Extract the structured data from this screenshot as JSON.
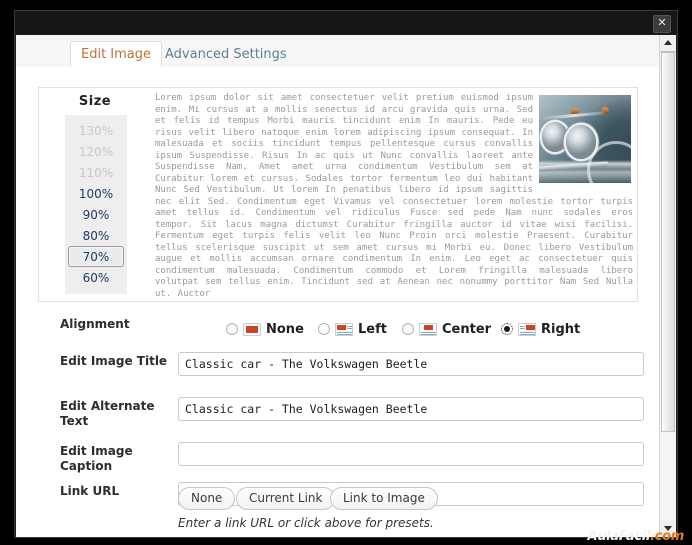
{
  "window": {
    "close_label": "✕"
  },
  "tabs": [
    {
      "label": "Edit Image",
      "active": true
    },
    {
      "label": "Advanced Settings",
      "active": false
    }
  ],
  "preview": {
    "size_heading": "Size",
    "size_options": [
      {
        "label": "130%",
        "state": "disabled"
      },
      {
        "label": "120%",
        "state": "disabled"
      },
      {
        "label": "110%",
        "state": "disabled"
      },
      {
        "label": "100%",
        "state": "enabled"
      },
      {
        "label": "90%",
        "state": "enabled"
      },
      {
        "label": "80%",
        "state": "enabled"
      },
      {
        "label": "70%",
        "state": "selected"
      },
      {
        "label": "60%",
        "state": "enabled"
      }
    ],
    "image_alt": "Classic car - The Volkswagen Beetle",
    "body_text": "Lorem ipsum dolor sit amet consectetuer velit pretium euismod ipsum enim. Mi cursus at a mollis senectus id arcu gravida quis urna. Sed et felis id tempus Morbi mauris tincidunt enim In mauris. Pede eu risus velit libero natoque enim lorem adipiscing ipsum consequat. In malesuada et sociis tincidunt tempus pellentesque cursus convallis ipsum Suspendisse. Risus In ac quis ut Nunc convallis laoreet ante Suspendisse Nam. Amet amet urna condimentum Vestibulum sem at Curabitur lorem et cursus. Sodales tortor fermentum leo dui habitant Nunc Sed Vestibulum. Ut lorem In penatibus libero id ipsum sagittis nec elit Sed. Condimentum eget Vivamus vel consectetuer lorem molestie tortor turpis amet tellus id. Condimentum vel ridiculus Fusce sed pede Nam nunc sodales eros tempor. Sit lacus magna dictumst Curabitur fringilla auctor id vitae wisi facilisi. Fermentum eget turpis felis velit leo Nunc Proin orci molestie Praesent. Curabitur tellus scelerisque suscipit ut sem amet cursus mi Morbi eu. Donec libero Vestibulum augue et mollis accumsan ornare condimentum In enim. Leo eget ac consectetuer quis condimentum malesuada. Condimentum commodo et Lorem fringilla malesuada libero volutpat sem tellus enim. Tincidunt sed at Aenean nec nonummy porttitor Nam Sed Nulla ut. Auctor"
  },
  "form": {
    "alignment": {
      "label": "Alignment",
      "options": [
        {
          "label": "None",
          "icon": "align-none-icon",
          "checked": false
        },
        {
          "label": "Left",
          "icon": "align-left-icon",
          "checked": false
        },
        {
          "label": "Center",
          "icon": "align-center-icon",
          "checked": false
        },
        {
          "label": "Right",
          "icon": "align-right-icon",
          "checked": true
        }
      ]
    },
    "image_title": {
      "label": "Edit Image Title",
      "value": "Classic car - The Volkswagen Beetle",
      "placeholder": ""
    },
    "alternate_text": {
      "label": "Edit Alternate Text",
      "value": "Classic car - The Volkswagen Beetle",
      "placeholder": ""
    },
    "image_caption": {
      "label": "Edit Image Caption",
      "value": "",
      "placeholder": ""
    },
    "link_url": {
      "label": "Link URL",
      "value": "",
      "placeholder": ""
    },
    "link_presets": [
      {
        "label": "None"
      },
      {
        "label": "Current Link"
      },
      {
        "label": "Link to Image"
      }
    ],
    "link_hint": "Enter a link URL or click above for presets."
  },
  "scrollbar": {
    "up_arrow": "▲",
    "down_arrow": "▼"
  },
  "watermark": {
    "name": "AulaFacil",
    "tld": ".com"
  },
  "colors": {
    "accent_tab": "#c0703a",
    "inactive_tab": "#5d7f92",
    "watermark_tld": "#e07a24",
    "size_text": "#1f3a68",
    "window_chrome": "#161616"
  }
}
